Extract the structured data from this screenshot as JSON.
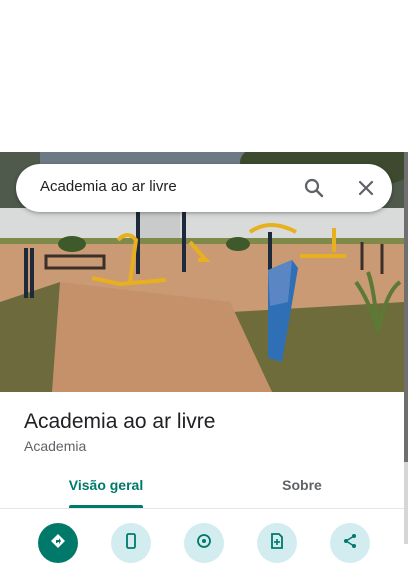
{
  "search": {
    "query": "Academia ao ar livre"
  },
  "place": {
    "title": "Academia ao ar livre",
    "category": "Academia"
  },
  "tabs": [
    {
      "label": "Visão geral",
      "active": true
    },
    {
      "label": "Sobre",
      "active": false
    }
  ],
  "actions": [
    {
      "icon": "directions-icon"
    },
    {
      "icon": "phone-icon"
    },
    {
      "icon": "location-icon"
    },
    {
      "icon": "save-icon"
    },
    {
      "icon": "share-icon"
    }
  ],
  "colors": {
    "accent": "#00796b",
    "action_bg": "#d2ecef"
  }
}
